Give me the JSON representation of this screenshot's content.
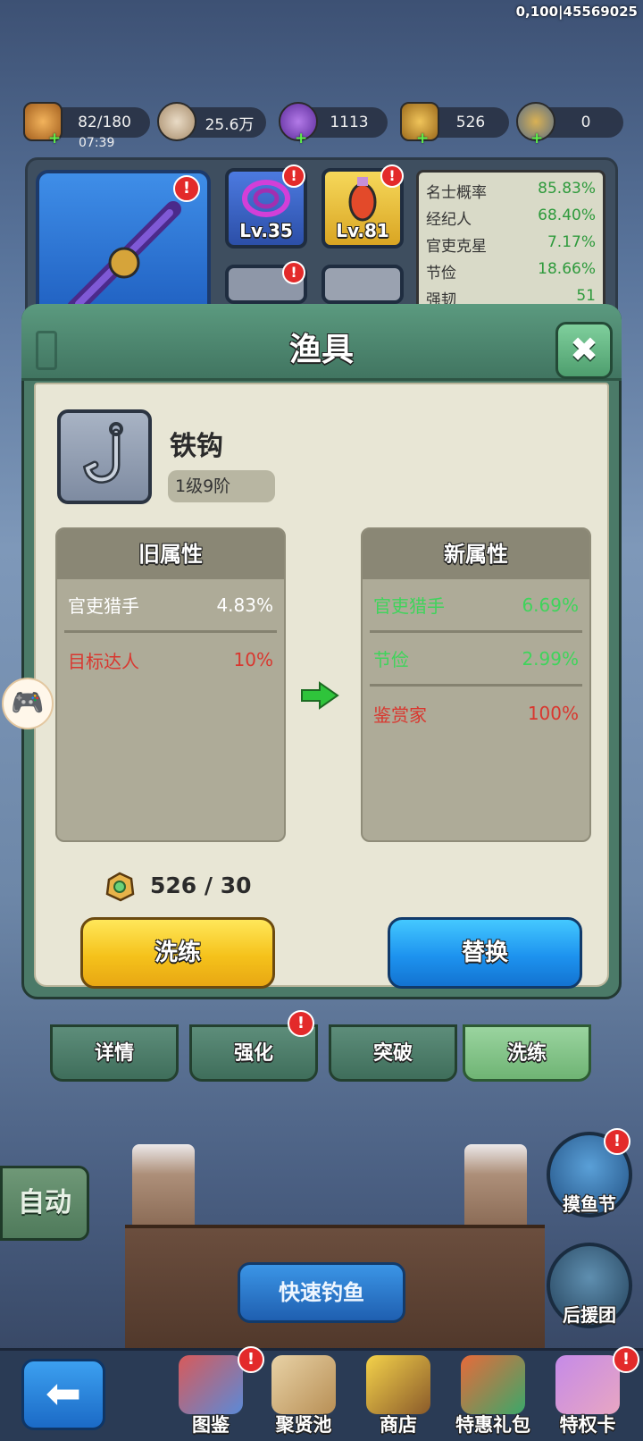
{
  "debug_id": "0,100|45569025",
  "resources": {
    "stamina": "82/180",
    "timer": "07:39",
    "coins": "25.6万",
    "gems": "1113",
    "stones": "526",
    "tridents": "0"
  },
  "background_gear": {
    "rod_level": "",
    "line_level": "Lv.35",
    "bait_level": "Lv.81",
    "stats": [
      {
        "name": "名士概率",
        "value": "85.83%"
      },
      {
        "name": "经纪人",
        "value": "68.40%"
      },
      {
        "name": "官吏克星",
        "value": "7.17%"
      },
      {
        "name": "节俭",
        "value": "18.66%"
      },
      {
        "name": "强韧",
        "value": "51"
      }
    ]
  },
  "modal": {
    "title": "渔具",
    "item_name": "铁钩",
    "item_grade": "1级9阶",
    "old_attrs": {
      "header": "旧属性",
      "rows": [
        {
          "name": "官吏猎手",
          "value": "4.83%",
          "color": "#ffffff"
        },
        {
          "name": "目标达人",
          "value": "10%",
          "color": "#d9372f"
        }
      ]
    },
    "new_attrs": {
      "header": "新属性",
      "rows": [
        {
          "name": "官吏猎手",
          "value": "6.69%",
          "color": "#3fd45b"
        },
        {
          "name": "节俭",
          "value": "2.99%",
          "color": "#3fd45b"
        },
        {
          "name": "鉴赏家",
          "value": "100%",
          "color": "#d9372f"
        }
      ]
    },
    "cost": "526 / 30",
    "refine_button": "洗练",
    "replace_button": "替换"
  },
  "tabs": [
    {
      "label": "详情",
      "active": false,
      "alert": false
    },
    {
      "label": "强化",
      "active": false,
      "alert": true
    },
    {
      "label": "突破",
      "active": false,
      "alert": false
    },
    {
      "label": "洗练",
      "active": true,
      "alert": false
    }
  ],
  "alert_glyph": "!",
  "close_glyph": "✖",
  "back_glyph": "⬅",
  "gamepad_glyph": "🎮",
  "scene": {
    "auto_label": "自动",
    "fast_fish_label": "快速钓鱼",
    "fish_festival_label": "摸鱼节",
    "support_label": "后援团"
  },
  "nav": [
    {
      "label": "图鉴",
      "icon": "book-icon",
      "alert": true
    },
    {
      "label": "聚贤池",
      "icon": "scroll-icon",
      "alert": false
    },
    {
      "label": "商店",
      "icon": "treasure-bowl-icon",
      "alert": false
    },
    {
      "label": "特惠礼包",
      "icon": "gift-pack-icon",
      "alert": false
    },
    {
      "label": "特权卡",
      "icon": "privilege-card-icon",
      "alert": true
    }
  ],
  "colors": {
    "accent_green": "#3fd45b",
    "accent_red": "#d9372f",
    "yellow_button": "#f5c21b",
    "blue_button": "#1d93ef",
    "modal_frame": "#4b7a68"
  }
}
